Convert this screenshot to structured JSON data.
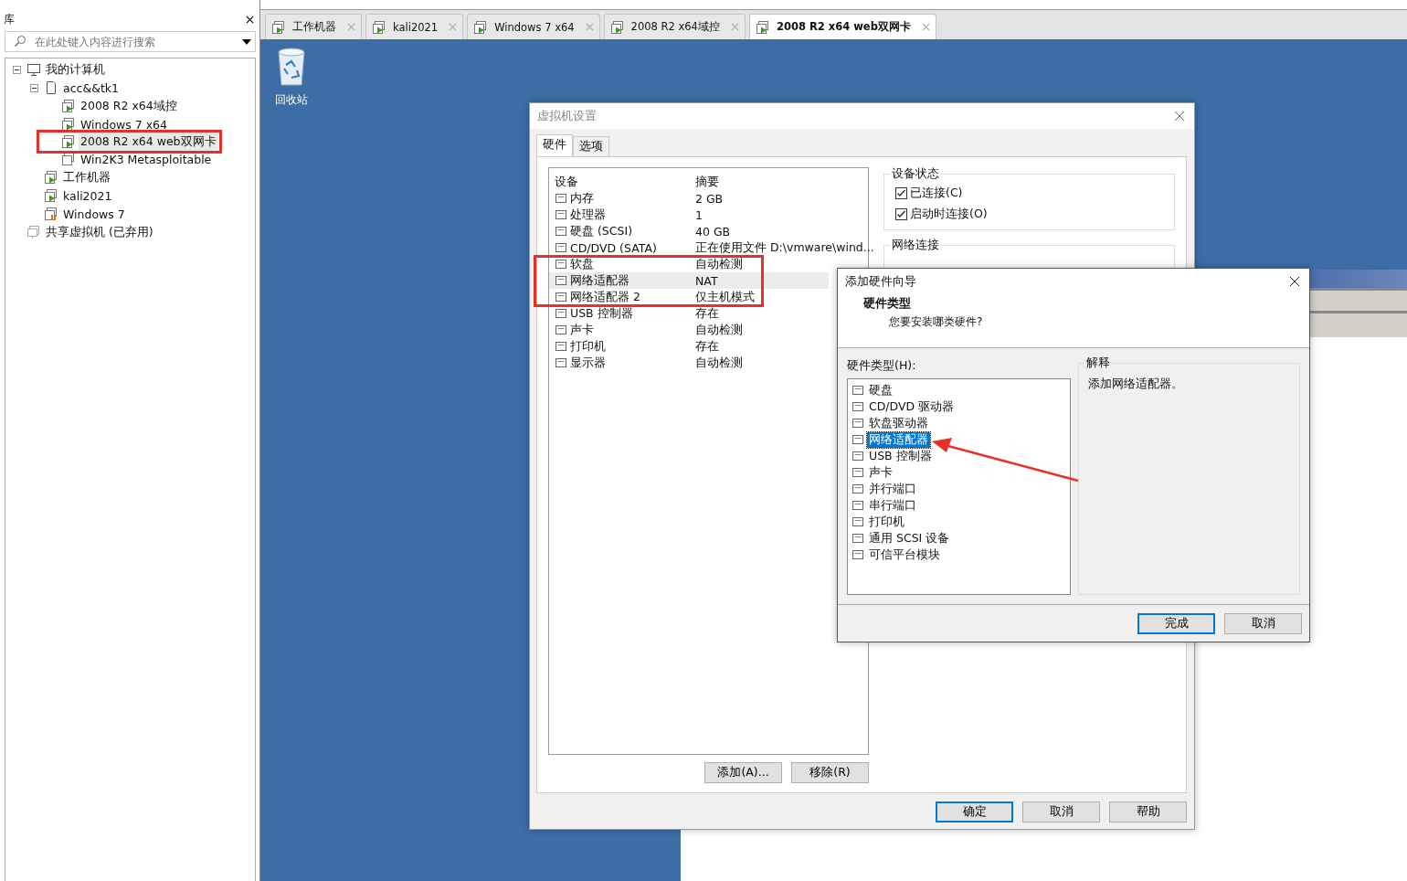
{
  "library": {
    "title": "库",
    "search": {
      "placeholder": "在此处键入内容进行搜索"
    },
    "tree": [
      {
        "label": "我的计算机",
        "kind": "computer",
        "expanded": true,
        "selected": false,
        "children": [
          {
            "label": "acc&&tk1",
            "kind": "folder",
            "expanded": true,
            "selected": false,
            "children": [
              {
                "label": "2008 R2 x64域控",
                "kind": "vm",
                "running": true,
                "suspended": false,
                "selected": false
              },
              {
                "label": "Windows 7 x64",
                "kind": "vm",
                "running": true,
                "suspended": false,
                "selected": false
              },
              {
                "label": "2008 R2 x64 web双网卡",
                "kind": "vm",
                "running": true,
                "suspended": false,
                "selected": true
              },
              {
                "label": "Win2K3 Metasploitable",
                "kind": "vm",
                "running": false,
                "suspended": false,
                "selected": false
              }
            ]
          },
          {
            "label": "工作机器",
            "kind": "vm",
            "running": true,
            "suspended": false,
            "selected": false
          },
          {
            "label": "kali2021",
            "kind": "vm",
            "running": true,
            "suspended": false,
            "selected": false
          },
          {
            "label": "Windows 7",
            "kind": "vm",
            "running": false,
            "suspended": true,
            "selected": false
          }
        ]
      },
      {
        "label": "共享虚拟机 (已弃用)",
        "kind": "shared",
        "selected": false
      }
    ]
  },
  "tabs": [
    {
      "label": "工作机器",
      "selected": false
    },
    {
      "label": "kali2021",
      "selected": false
    },
    {
      "label": "Windows 7 x64",
      "selected": false
    },
    {
      "label": "2008 R2 x64域控",
      "selected": false
    },
    {
      "label": "2008 R2 x64 web双网卡",
      "selected": true
    }
  ],
  "desktop": {
    "icons": [
      {
        "label": "回收站"
      }
    ]
  },
  "settings_dialog": {
    "title": "虚拟机设置",
    "tabs": [
      {
        "label": "硬件",
        "selected": true
      },
      {
        "label": "选项",
        "selected": false
      }
    ],
    "columns": [
      "设备",
      "摘要"
    ],
    "devices": [
      {
        "name": "内存",
        "summary": "2 GB",
        "selected": false
      },
      {
        "name": "处理器",
        "summary": "1",
        "selected": false
      },
      {
        "name": "硬盘 (SCSI)",
        "summary": "40 GB",
        "selected": false
      },
      {
        "name": "CD/DVD (SATA)",
        "summary": "正在使用文件 D:\\vmware\\wind...",
        "selected": false
      },
      {
        "name": "软盘",
        "summary": "自动检测",
        "selected": false
      },
      {
        "name": "网络适配器",
        "summary": "NAT",
        "selected": true
      },
      {
        "name": "网络适配器 2",
        "summary": "仅主机模式",
        "selected": false
      },
      {
        "name": "USB 控制器",
        "summary": "存在",
        "selected": false
      },
      {
        "name": "声卡",
        "summary": "自动检测",
        "selected": false
      },
      {
        "name": "打印机",
        "summary": "存在",
        "selected": false
      },
      {
        "name": "显示器",
        "summary": "自动检测",
        "selected": false
      }
    ],
    "device_status": {
      "title": "设备状态",
      "options": [
        {
          "label": "已连接(C)",
          "checked": true
        },
        {
          "label": "启动时连接(O)",
          "checked": true
        }
      ]
    },
    "network": {
      "title": "网络连接"
    },
    "list_buttons": [
      "添加(A)...",
      "移除(R)"
    ],
    "buttons": [
      {
        "label": "确定",
        "default": true
      },
      {
        "label": "取消",
        "default": false
      },
      {
        "label": "帮助",
        "default": false
      }
    ]
  },
  "wizard": {
    "title": "添加硬件向导",
    "heading": "硬件类型",
    "subheading": "您要安装哪类硬件?",
    "list_label": "硬件类型(H):",
    "items": [
      {
        "label": "硬盘",
        "selected": false
      },
      {
        "label": "CD/DVD 驱动器",
        "selected": false
      },
      {
        "label": "软盘驱动器",
        "selected": false
      },
      {
        "label": "网络适配器",
        "selected": true
      },
      {
        "label": "USB 控制器",
        "selected": false
      },
      {
        "label": "声卡",
        "selected": false
      },
      {
        "label": "并行端口",
        "selected": false
      },
      {
        "label": "串行端口",
        "selected": false
      },
      {
        "label": "打印机",
        "selected": false
      },
      {
        "label": "通用 SCSI 设备",
        "selected": false
      },
      {
        "label": "可信平台模块",
        "selected": false
      }
    ],
    "explanation": {
      "title": "解释",
      "text": "添加网络适配器。"
    },
    "buttons": [
      {
        "label": "完成",
        "default": true
      },
      {
        "label": "取消",
        "default": false
      }
    ]
  }
}
